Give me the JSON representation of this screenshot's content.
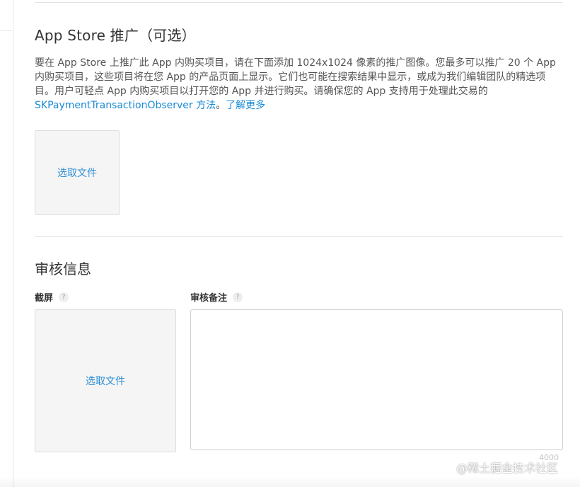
{
  "promo": {
    "title": "App Store 推广（可选）",
    "description_text": "要在 App Store 上推广此 App 内购买项目，请在下面添加 1024x1024 像素的推广图像。您最多可以推广 20 个 App 内购买项目，这些项目将在您 App 的产品页面上显示。它们也可能在搜索结果中显示，或成为我们编辑团队的精选项目。用户可轻点 App 内购买项目以打开您的 App 并进行购买。请确保您的 App 支持用于处理此交易的 ",
    "method_link": "SKPaymentTransactionObserver 方法",
    "period": "。",
    "learn_more_link": "了解更多",
    "choose_file_label": "选取文件"
  },
  "review": {
    "title": "审核信息",
    "screenshot_label": "截屏",
    "screenshot_help": "?",
    "screenshot_choose_file": "选取文件",
    "notes_label": "审核备注",
    "notes_help": "?",
    "notes_value": "",
    "notes_char_limit": "4000"
  },
  "watermark": "@稀土掘金技术社区",
  "colors": {
    "link": "#1a8ad6",
    "upload_background": "#f5f5f5",
    "divider": "#e3e3e3"
  }
}
